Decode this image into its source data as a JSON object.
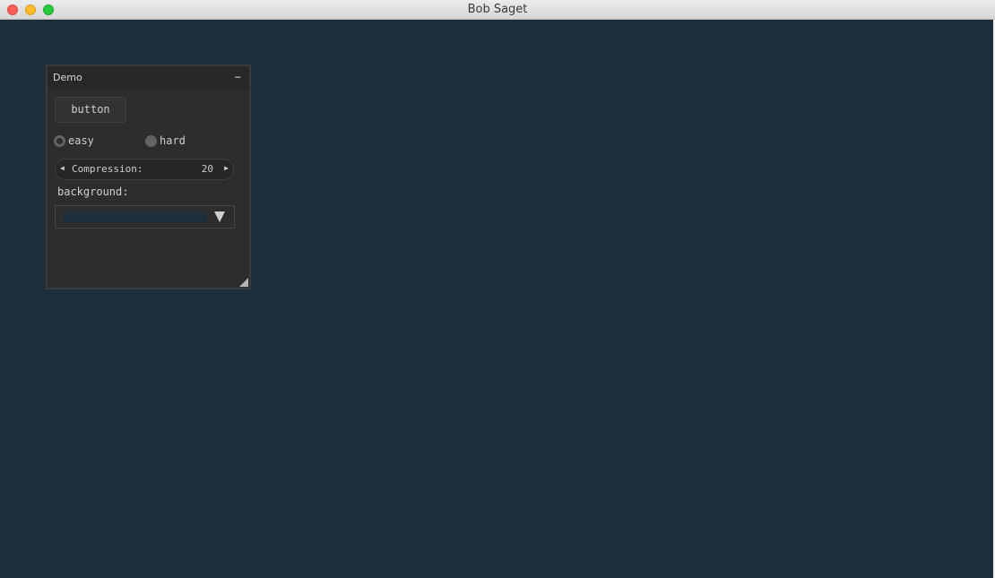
{
  "window": {
    "title": "Bob Saget",
    "background_color": "#1f2e3b"
  },
  "panel": {
    "title": "Demo",
    "minimize_symbol": "−",
    "button_label": "button",
    "difficulty": {
      "options": [
        "easy",
        "hard"
      ],
      "selected": "easy"
    },
    "compression": {
      "label": "Compression:",
      "value": "20",
      "decrement_symbol": "◀",
      "increment_symbol": "▶"
    },
    "background": {
      "label": "background:",
      "color": "#1f2e3b"
    }
  },
  "icons": {
    "traffic_lights": [
      "close-icon",
      "minimize-icon",
      "maximize-icon"
    ],
    "combo_arrow": "triangle-down-icon",
    "resize_grip": "resize-grip-icon"
  }
}
